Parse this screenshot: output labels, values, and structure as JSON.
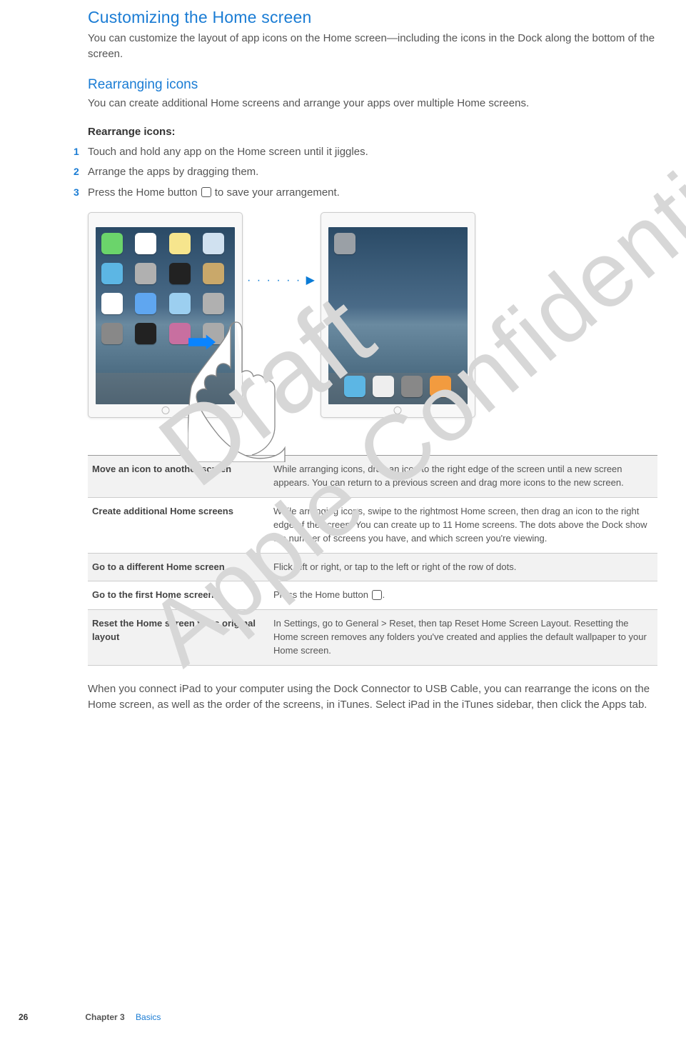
{
  "sections": {
    "customizing": {
      "heading": "Customizing the Home screen",
      "body": "You can customize the layout of app icons on the Home screen—including the icons in the Dock along the bottom of the screen."
    },
    "rearranging": {
      "heading": "Rearranging icons",
      "body": "You can create additional Home screens and arrange your apps over multiple Home screens.",
      "label": "Rearrange icons:",
      "steps": [
        "Touch and hold any app on the Home screen until it jiggles.",
        "Arrange the apps by dragging them.",
        "Press the Home button  to save your arrangement."
      ]
    }
  },
  "table": [
    {
      "k": "Move an icon to another screen",
      "v": "While arranging icons, drag an icon to the right edge of the screen until a new screen appears. You can return to a previous screen and drag more icons to the new screen.",
      "shade": true
    },
    {
      "k": "Create additional Home screens",
      "v": "While arranging icons, swipe to the rightmost Home screen, then drag an icon to the right edge of the screen. You can create up to 11 Home screens. The dots above the Dock show the number of screens you have, and which screen you're viewing.",
      "shade": false
    },
    {
      "k": "Go to a different Home screen",
      "v": "Flick left or right, or tap to the left or right of the row of dots.",
      "shade": true
    },
    {
      "k": "Go to the first Home screen",
      "v": "Press the Home button .",
      "shade": false,
      "home_icon": true
    },
    {
      "k": "Reset the Home screen to its original layout",
      "v": "In Settings, go to General > Reset, then tap Reset Home Screen Layout. Resetting the Home screen removes any folders you've created and applies the default wallpaper to your Home screen.",
      "shade": true
    }
  ],
  "after": "When you connect iPad to your computer using the Dock Connector to USB Cable, you can rearrange the icons on the Home screen, as well as the order of the screens, in iTunes. Select iPad in the iTunes sidebar, then click the Apps tab.",
  "watermarks": {
    "draft": "Draft",
    "confidential": "Apple Confidential"
  },
  "footer": {
    "page": "26",
    "chapter_label": "Chapter 3",
    "chapter_name": "Basics"
  }
}
